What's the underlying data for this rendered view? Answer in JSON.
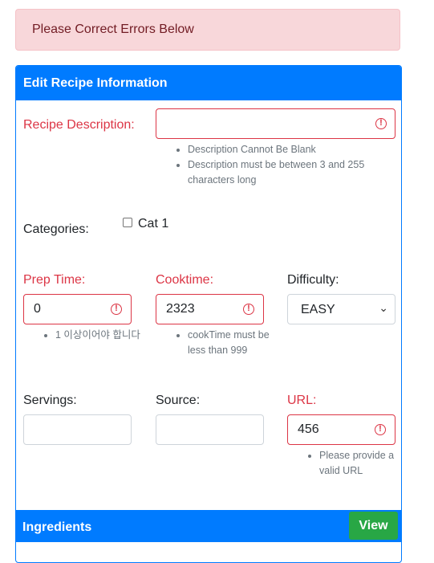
{
  "alert": {
    "text": "Please Correct Errors Below"
  },
  "card": {
    "title": "Edit Recipe Information"
  },
  "form": {
    "description": {
      "label": "Recipe Description:",
      "value": "",
      "errors": [
        "Description Cannot Be Blank",
        "Description must be between 3 and 255 characters long"
      ]
    },
    "categories": {
      "label": "Categories:",
      "options": [
        {
          "label": "Cat 1",
          "checked": false
        }
      ]
    },
    "prep_time": {
      "label": "Prep Time:",
      "value": "0",
      "errors": [
        "1 이상이어야 합니다"
      ]
    },
    "cook_time": {
      "label": "Cooktime:",
      "value": "2323",
      "errors": [
        "cookTime must be less than 999"
      ]
    },
    "difficulty": {
      "label": "Difficulty:",
      "value": "EASY"
    },
    "servings": {
      "label": "Servings:",
      "value": ""
    },
    "source": {
      "label": "Source:",
      "value": ""
    },
    "url": {
      "label": "URL:",
      "value": "456",
      "errors": [
        "Please provide a valid URL"
      ]
    }
  },
  "ingredients": {
    "title": "Ingredients",
    "view_label": "View"
  },
  "icons": {
    "error": "exclamation-circle-icon",
    "dropdown": "chevron-down-icon"
  },
  "colors": {
    "primary": "#007bff",
    "danger": "#dc3545",
    "success": "#28a745",
    "alert_bg": "#f8d7da"
  }
}
